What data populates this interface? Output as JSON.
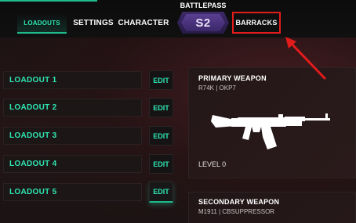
{
  "nav": {
    "loadouts": "LOADOUTS",
    "settings": "SETTINGS",
    "character": "CHARACTER",
    "barracks": "BARRACKS"
  },
  "battlepass": {
    "label": "BATTLEPASS",
    "season": "S2"
  },
  "loadouts": [
    {
      "label": "LOADOUT 1",
      "edit": "EDIT"
    },
    {
      "label": "LOADOUT 2",
      "edit": "EDIT"
    },
    {
      "label": "LOADOUT 3",
      "edit": "EDIT"
    },
    {
      "label": "LOADOUT 4",
      "edit": "EDIT"
    },
    {
      "label": "LOADOUT 5",
      "edit": "EDIT"
    }
  ],
  "primary": {
    "title": "PRIMARY WEAPON",
    "detail": "R74K | OKP7",
    "level": "LEVEL 0"
  },
  "secondary": {
    "title": "SECONDARY WEAPON",
    "detail": "M1911 | CBSUPPRESSOR"
  },
  "colors": {
    "accent": "#1fb98c",
    "accent_text": "#2ee6b0",
    "highlight": "#e21b1b",
    "battlepass": "#5b3f92"
  },
  "icons": {
    "weapon": "rifle-silhouette-icon",
    "annotation": "red-arrow-icon"
  }
}
